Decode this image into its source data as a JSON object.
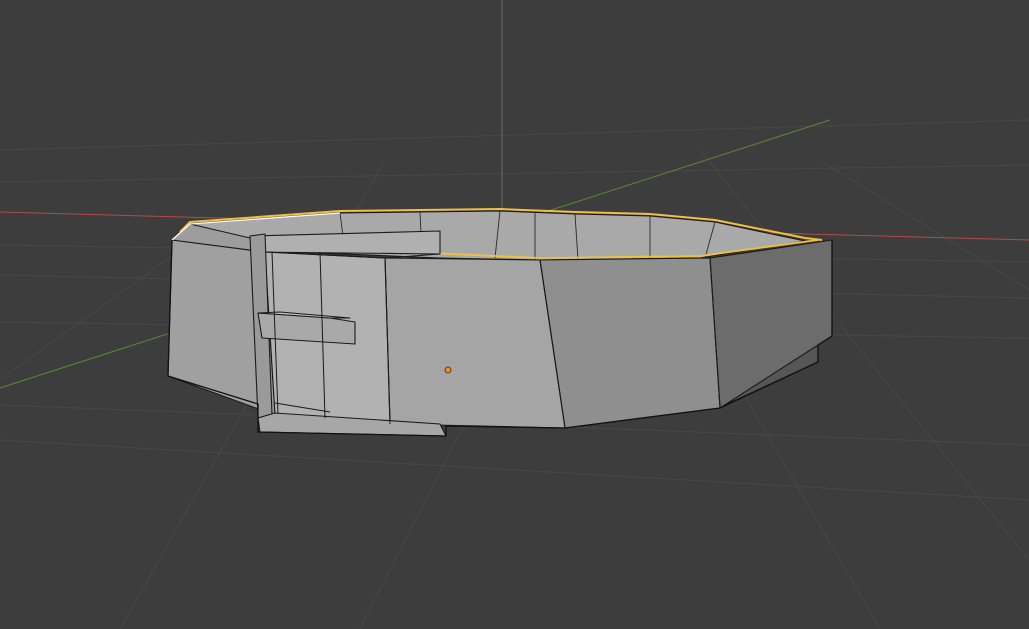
{
  "viewport": {
    "mode": "Edit Mode",
    "shading": "solid",
    "background_color": "#3d3d3d",
    "grid_color": "#4a4a4a"
  },
  "axes": {
    "x_color": "#d94c4c",
    "y_color": "#6a9a3a",
    "z_color": "#7a7a7a"
  },
  "object": {
    "semantic_name": "belt-with-buckle-mesh",
    "selection_color": "#f0c040",
    "origin_color": "#f08a24",
    "edge_color": "#1a1a1a"
  }
}
